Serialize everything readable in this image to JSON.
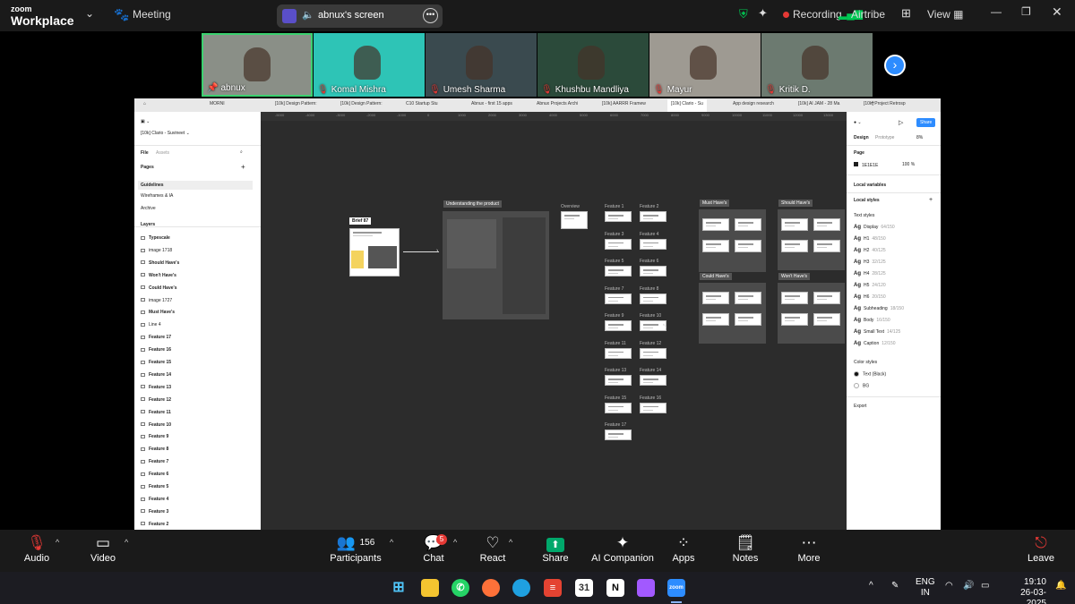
{
  "topbar": {
    "logo_line1": "zoom",
    "logo_line2": "Workplace",
    "meeting_label": "Meeting",
    "share_label": "abnux's screen",
    "recording_label": "Recording",
    "network_label": "Airtribe",
    "view_label": "View"
  },
  "participants": [
    {
      "name": "abnux",
      "muted": false,
      "bg": "#8a8f87"
    },
    {
      "name": "Komal Mishra",
      "muted": true,
      "bg": "#2ec4b6"
    },
    {
      "name": "Umesh Sharma",
      "muted": true,
      "bg": "#3a4a4f"
    },
    {
      "name": "Khushbu Mandliya",
      "muted": true,
      "bg": "#2b4a3a"
    },
    {
      "name": "Mayur",
      "muted": true,
      "bg": "#9e9a92"
    },
    {
      "name": "Kritik D.",
      "muted": true,
      "bg": "#6c7a70"
    }
  ],
  "figma": {
    "tabs": [
      "MORNI",
      "[10k] Design Pattern:",
      "[10k] Design Pattern:",
      "C10 Startup Stu",
      "Abnux - first 15 apps",
      "Abnux Projects Archi",
      "[10k] AARRR Framew",
      "[10k] Clario - Su",
      "App design research",
      "[10k] AI JAM - 28 Ma",
      "[10k] Project Retrosp"
    ],
    "file_title": "[10k] Clario - Suvineet",
    "panel_tabs": {
      "file": "File",
      "assets": "Assets"
    },
    "pages_header": "Pages",
    "pages": [
      "Guidelines",
      "Wireframes & IA",
      "Archive"
    ],
    "layers_header": "Layers",
    "layers": [
      "Typescale",
      "image 1718",
      "Should Have's",
      "Won't Have's",
      "Could Have's",
      "image 1727",
      "Must Have's",
      "Line 4",
      "Feature 17",
      "Feature 16",
      "Feature 15",
      "Feature 14",
      "Feature 13",
      "Feature 12",
      "Feature 11",
      "Feature 10",
      "Feature 9",
      "Feature 8",
      "Feature 7",
      "Feature 6",
      "Feature 5",
      "Feature 4",
      "Feature 3",
      "Feature 2"
    ],
    "ruler": [
      "-5000",
      "-4000",
      "-3000",
      "-2000",
      "-1000",
      "0",
      "1000",
      "2000",
      "3000",
      "4000",
      "5000",
      "6000",
      "7000",
      "8000",
      "9000",
      "10000",
      "11000",
      "12000",
      "13000",
      "14000"
    ],
    "right": {
      "design_tab": "Design",
      "prototype_tab": "Prototype",
      "zoom": "8%",
      "share_btn": "Share",
      "page_header": "Page",
      "page_color": "1E1E1E",
      "page_opacity": "100",
      "local_variables": "Local variables",
      "local_styles": "Local styles",
      "text_styles_header": "Text styles",
      "text_styles": [
        {
          "name": "Display",
          "spec": "64/150"
        },
        {
          "name": "H1",
          "spec": "48/150"
        },
        {
          "name": "H2",
          "spec": "40/125"
        },
        {
          "name": "H3",
          "spec": "32/125"
        },
        {
          "name": "H4",
          "spec": "28/125"
        },
        {
          "name": "H5",
          "spec": "24/120"
        },
        {
          "name": "H6",
          "spec": "20/150"
        },
        {
          "name": "Subheading",
          "spec": "18/150"
        },
        {
          "name": "Body",
          "spec": "16/150"
        },
        {
          "name": "Small Text",
          "spec": "14/125"
        },
        {
          "name": "Caption",
          "spec": "12/150"
        }
      ],
      "color_styles_header": "Color styles",
      "color_styles": [
        {
          "name": "Text (Black)",
          "color": "#111111"
        },
        {
          "name": "BG",
          "color": "#ffffff"
        }
      ],
      "export": "Export"
    },
    "canvas": {
      "brief_label": "Brief 87",
      "understanding_label": "Understanding the product",
      "overview_label": "Overview",
      "features": [
        "Feature 1",
        "Feature 2",
        "Feature 3",
        "Feature 4",
        "Feature 5",
        "Feature 6",
        "Feature 7",
        "Feature 8",
        "Feature 9",
        "Feature 10",
        "Feature 11",
        "Feature 12",
        "Feature 13",
        "Feature 14",
        "Feature 15",
        "Feature 16",
        "Feature 17"
      ],
      "must": "Must Have's",
      "should": "Should Have's",
      "could": "Could Have's",
      "wont": "Won't Have's"
    }
  },
  "bottombar": {
    "audio": "Audio",
    "video": "Video",
    "participants": "Participants",
    "participants_count": "156",
    "chat": "Chat",
    "chat_badge": "5",
    "react": "React",
    "share": "Share",
    "ai": "AI Companion",
    "apps": "Apps",
    "notes": "Notes",
    "more": "More",
    "leave": "Leave"
  },
  "taskbar": {
    "lang1": "ENG",
    "lang2": "IN",
    "time": "19:10",
    "date": "26-03-2025"
  },
  "colors": {
    "accent": "#2d8cff",
    "red": "#e53935",
    "green": "#00c853",
    "share_green": "#00a86b"
  }
}
